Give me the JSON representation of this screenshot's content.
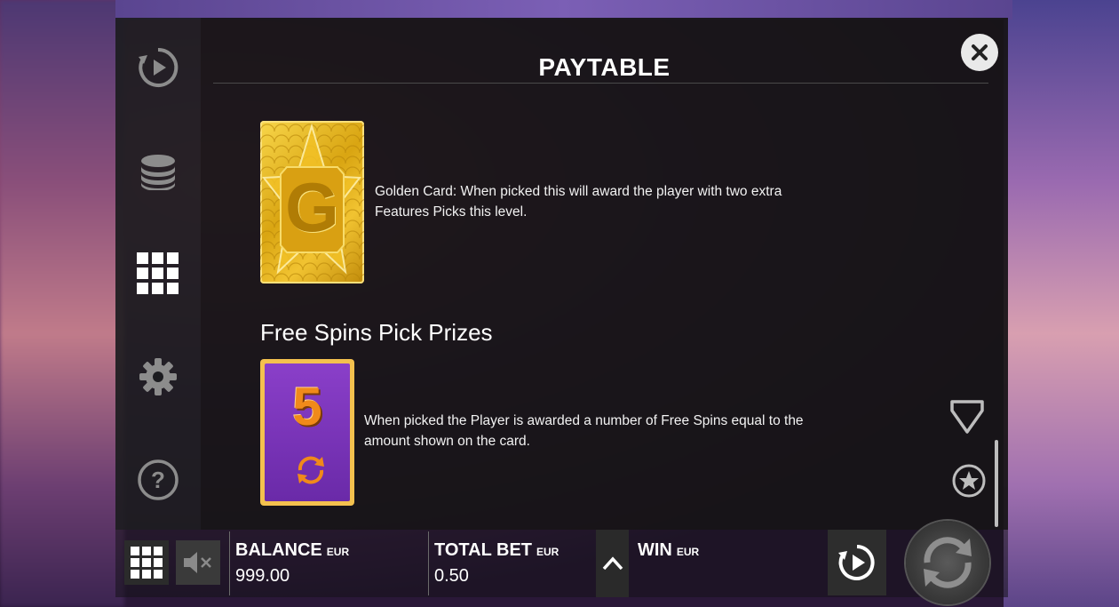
{
  "paytable": {
    "title": "PAYTABLE",
    "golden_card": {
      "letter": "G",
      "line1": "Golden Card: When picked this will award the player with two extra",
      "line2": "Features Picks this level."
    },
    "free_spins": {
      "heading": "Free Spins Pick Prizes",
      "card_number": "5",
      "line1": "When picked the Player is awarded a number of Free Spins equal to the",
      "line2": "amount shown on the card."
    }
  },
  "bottom_bar": {
    "balance": {
      "label": "BALANCE",
      "unit": "EUR",
      "value": "999.00"
    },
    "total_bet": {
      "label": "TOTAL BET",
      "unit": "EUR",
      "value": "0.50"
    },
    "win": {
      "label": "WIN",
      "unit": "EUR",
      "value": ""
    }
  },
  "colors": {
    "gold": "#e0ad1a",
    "purple": "#7a35b8",
    "orange": "#f08a1a"
  },
  "icons": {
    "sidebar": [
      "autoplay-icon",
      "coins-icon",
      "paytable-grid-icon",
      "settings-gear-icon",
      "help-icon"
    ],
    "bottom": [
      "menu-grid-icon",
      "mute-icon",
      "chevron-up-icon",
      "autoplay-icon",
      "spin-icon"
    ],
    "scroll": [
      "shield-icon",
      "star-icon"
    ]
  }
}
